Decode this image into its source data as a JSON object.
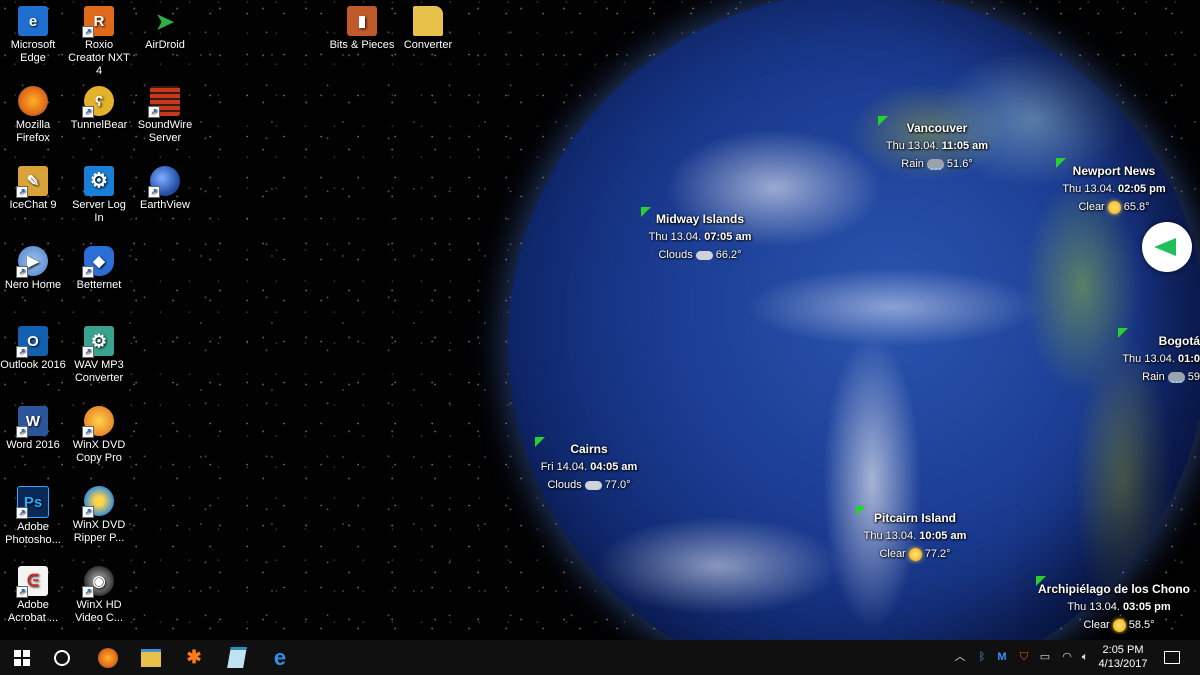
{
  "desktop_icons": [
    {
      "label": "Microsoft Edge",
      "icon": "edge-icon",
      "color": "#1f6fd1"
    },
    {
      "label": "Roxio Creator NXT 4",
      "icon": "roxio-icon",
      "color": "#e06a1b"
    },
    {
      "label": "AirDroid",
      "icon": "airdroid-icon",
      "color": "#2fae43"
    },
    {
      "label": "Bits & Pieces",
      "icon": "bits-pieces-icon",
      "color": "#c05a2a"
    },
    {
      "label": "Converter",
      "icon": "folder-icon",
      "color": "#e8c14a"
    },
    {
      "label": "Mozilla Firefox",
      "icon": "firefox-icon",
      "color": "#e36c17"
    },
    {
      "label": "TunnelBear",
      "icon": "tunnelbear-icon",
      "color": "#e3b22a"
    },
    {
      "label": "SoundWire Server",
      "icon": "soundwire-icon",
      "color": "#c23a1a"
    },
    {
      "label": "IceChat 9",
      "icon": "icechat-icon",
      "color": "#d9a33a"
    },
    {
      "label": "Server Log In",
      "icon": "gear-icon",
      "color": "#1a7fd6"
    },
    {
      "label": "EarthView",
      "icon": "earthview-icon",
      "color": "#3a6fc4"
    },
    {
      "label": "Nero Home",
      "icon": "nero-icon",
      "color": "#4a7fc9"
    },
    {
      "label": "Betternet",
      "icon": "betternet-icon",
      "color": "#2b6fd6"
    },
    {
      "label": "Outlook 2016",
      "icon": "outlook-icon",
      "color": "#1261b0"
    },
    {
      "label": "WAV MP3 Converter",
      "icon": "wav-mp3-icon",
      "color": "#3aa38f"
    },
    {
      "label": "Word 2016",
      "icon": "word-icon",
      "color": "#2b579a"
    },
    {
      "label": "WinX DVD Copy Pro",
      "icon": "winx-copy-icon",
      "color": "#e06a1b"
    },
    {
      "label": "Adobe Photosho...",
      "icon": "photoshop-icon",
      "color": "#0a2a55"
    },
    {
      "label": "WinX DVD Ripper P...",
      "icon": "winx-ripper-icon",
      "color": "#3a8fd6"
    },
    {
      "label": "Adobe Acrobat ...",
      "icon": "acrobat-icon",
      "color": "#d42a1a"
    },
    {
      "label": "WinX HD Video C...",
      "icon": "winx-hd-icon",
      "color": "#555555"
    }
  ],
  "locations": [
    {
      "name": "Vancouver",
      "date": "Thu 13.04.",
      "time": "11:05 am",
      "weather": "Rain",
      "temp": "51.6°",
      "wx": "rain"
    },
    {
      "name": "Newport News",
      "date": "Thu 13.04.",
      "time": "02:05 pm",
      "weather": "Clear",
      "temp": "65.8°",
      "wx": "sun"
    },
    {
      "name": "Midway Islands",
      "date": "Thu 13.04.",
      "time": "07:05 am",
      "weather": "Clouds",
      "temp": "66.2°",
      "wx": "cloud"
    },
    {
      "name": "Bogotá",
      "date": "Thu 13.04.",
      "time": "01:0",
      "weather": "Rain",
      "temp": "59",
      "wx": "rain"
    },
    {
      "name": "Cairns",
      "date": "Fri 14.04.",
      "time": "04:05 am",
      "weather": "Clouds",
      "temp": "77.0°",
      "wx": "cloud"
    },
    {
      "name": "Pitcairn Island",
      "date": "Thu 13.04.",
      "time": "10:05 am",
      "weather": "Clear",
      "temp": "77.2°",
      "wx": "sun"
    },
    {
      "name": "Archipiélago de los Chono",
      "date": "Thu 13.04.",
      "time": "03:05 pm",
      "weather": "Clear",
      "temp": "58.5°",
      "wx": "sun"
    }
  ],
  "taskbar": {
    "pinned": [
      "windows-start-icon",
      "cortana-circle-icon",
      "firefox-icon",
      "file-explorer-icon",
      "avast-icon",
      "notepad-icon",
      "edge-icon"
    ],
    "tray": [
      "chevron-up-icon",
      "bluetooth-icon",
      "malwarebytes-icon",
      "shield-icon",
      "battery-icon",
      "wifi-icon",
      "volume-icon"
    ],
    "clock_time": "2:05 PM",
    "clock_date": "4/13/2017"
  },
  "colors": {
    "flag": "#29d12e",
    "accent": "#1fbf5a",
    "taskbar": "#101010"
  }
}
